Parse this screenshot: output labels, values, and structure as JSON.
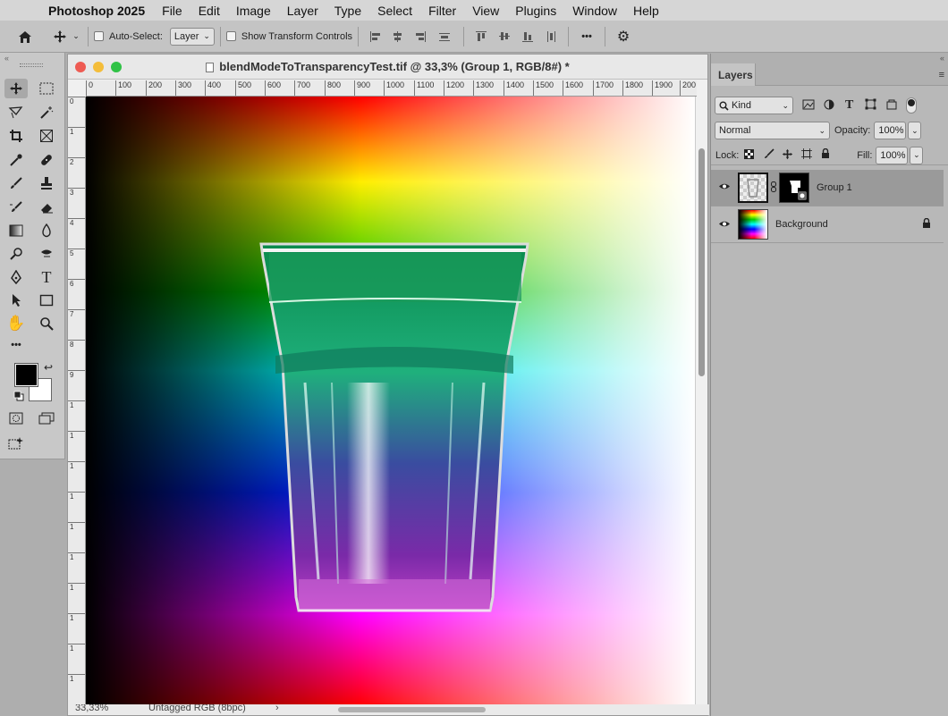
{
  "menubar": {
    "apple": "",
    "app_name": "Photoshop 2025",
    "items": [
      "File",
      "Edit",
      "Image",
      "Layer",
      "Type",
      "Select",
      "Filter",
      "View",
      "Plugins",
      "Window",
      "Help"
    ]
  },
  "options_bar": {
    "auto_select_label": "Auto-Select:",
    "auto_select_value": "Layer",
    "show_transform_label": "Show Transform Controls",
    "more_label": "•••"
  },
  "document": {
    "title": "blendModeToTransparencyTest.tif @ 33,3% (Group 1, RGB/8#) *",
    "zoom": "33,33%",
    "profile": "Untagged RGB (8bpc)",
    "status_arrow": "›",
    "ruler_h": [
      "0",
      "100",
      "200",
      "300",
      "400",
      "500",
      "600",
      "700",
      "800",
      "900",
      "1000",
      "1100",
      "1200",
      "1300",
      "1400",
      "1500",
      "1600",
      "1700",
      "1800",
      "1900",
      "200"
    ],
    "ruler_v": [
      "0",
      "1",
      "2",
      "3",
      "4",
      "5",
      "6",
      "7",
      "8",
      "9",
      "1",
      "1",
      "1",
      "1",
      "1",
      "1",
      "1",
      "1",
      "1",
      "1"
    ]
  },
  "layers_panel": {
    "tab": "Layers",
    "filter_label": "Kind",
    "blend_mode": "Normal",
    "opacity_label": "Opacity:",
    "opacity_value": "100%",
    "lock_label": "Lock:",
    "fill_label": "Fill:",
    "fill_value": "100%",
    "layers": [
      {
        "name": "Group 1",
        "visible": true,
        "selected": true
      },
      {
        "name": "Background",
        "visible": true,
        "locked": true
      }
    ]
  },
  "colors": {
    "selected_layer": "#9a9a9a",
    "foreground": "#000000",
    "background": "#ffffff",
    "close": "#ee5b53",
    "minimize": "#f4bd3a",
    "zoom": "#30c246"
  }
}
